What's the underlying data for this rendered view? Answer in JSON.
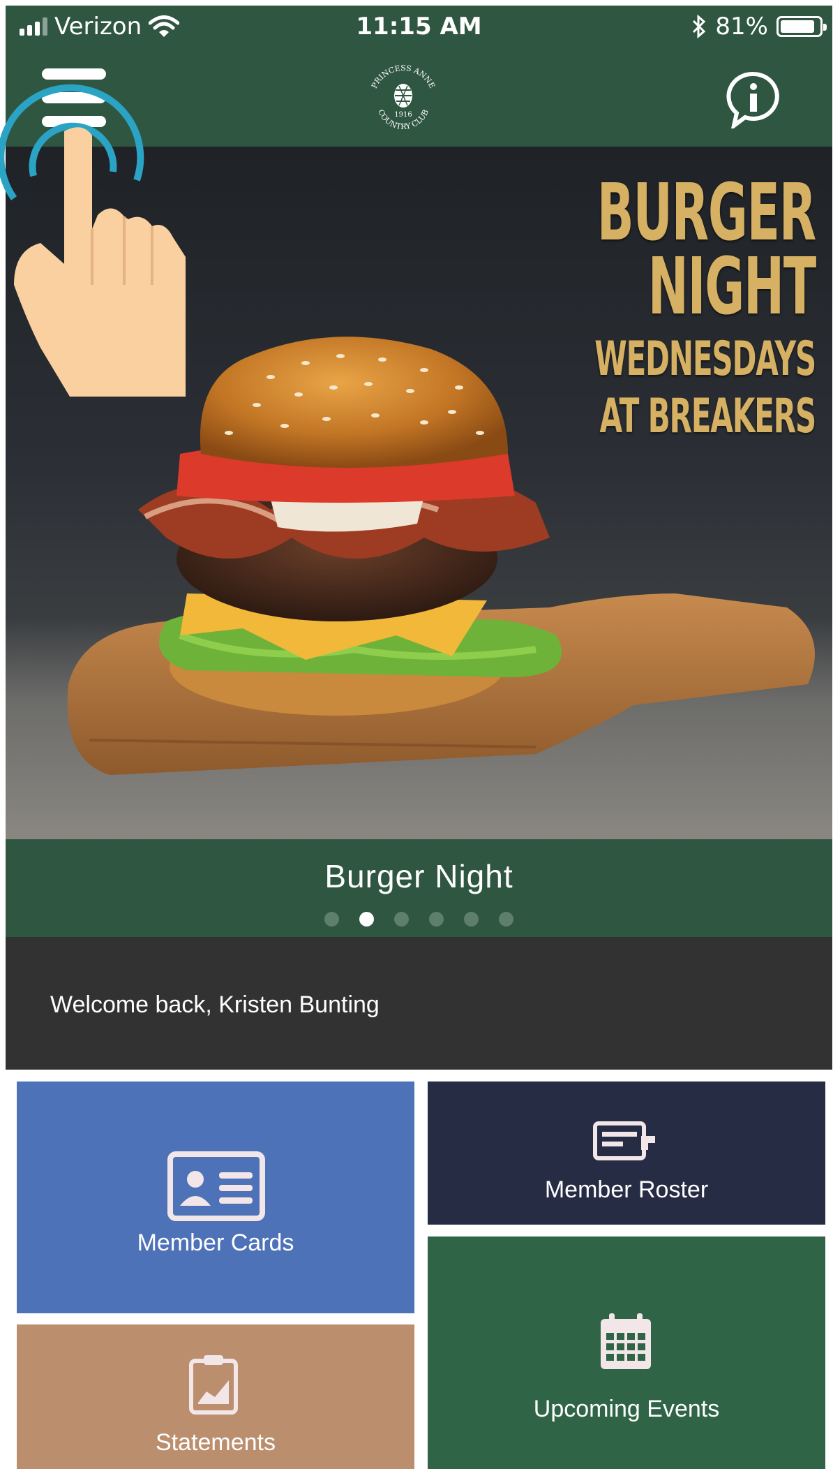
{
  "status_bar": {
    "carrier": "Verizon",
    "time": "11:15 AM",
    "battery": "81%",
    "battery_level": 0.81,
    "icons": [
      "signal-icon",
      "wifi-icon",
      "bluetooth-icon",
      "battery-icon"
    ]
  },
  "header": {
    "logo_text": "PRINCESS ANNE COUNTRY CLUB 1916",
    "menu_icon": "hamburger-menu-icon",
    "info_icon": "info-icon"
  },
  "hero": {
    "promo_line1": "BURGER",
    "promo_line2": "NIGHT",
    "promo_line3": "WEDNESDAYS",
    "promo_line4": "AT BREAKERS",
    "image": "burger-photo"
  },
  "carousel": {
    "title": "Burger Night",
    "dot_count": 6,
    "active_index": 1
  },
  "welcome": {
    "message": "Welcome back, Kristen Bunting"
  },
  "tiles": {
    "member_cards": "Member Cards",
    "member_roster": "Member Roster",
    "upcoming_events": "Upcoming Events",
    "statements": "Statements"
  },
  "colors": {
    "header_green": "#2f5640",
    "cards_blue": "#4e72b8",
    "roster_navy": "#262c44",
    "events_green": "#2f6447",
    "statements_tan": "#bb8f6e",
    "welcome_dark": "#323232",
    "promo_gold": "#d6b063",
    "tap_ring": "#2aa3c4"
  }
}
